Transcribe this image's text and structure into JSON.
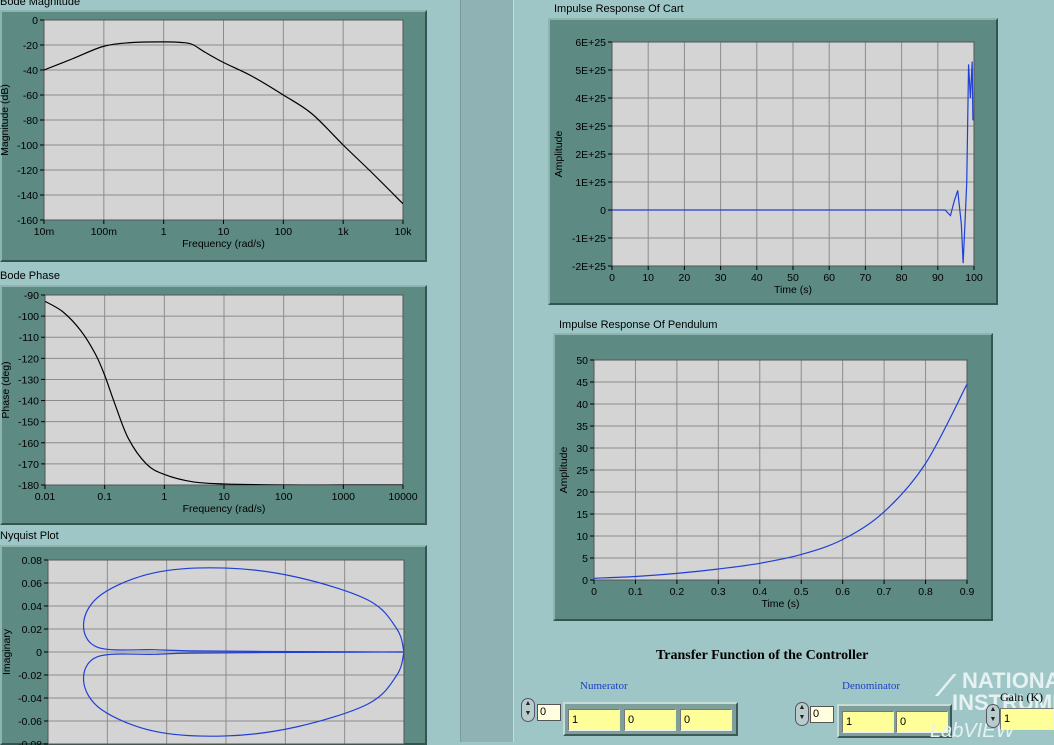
{
  "left_panel": {
    "bode_magnitude": {
      "title": "Bode Magnitude",
      "ylabel": "Magnitude (dB)",
      "xlabel": "Frequency (rad/s)",
      "yticks": [
        "0",
        "-20",
        "-40",
        "-60",
        "-80",
        "-100",
        "-120",
        "-140",
        "-160"
      ],
      "xticks": [
        "10m",
        "100m",
        "1",
        "10",
        "100",
        "1k",
        "10k"
      ]
    },
    "bode_phase": {
      "title": "Bode Phase",
      "ylabel": "Phase (deg)",
      "xlabel": "Frequency (rad/s)",
      "yticks": [
        "-90",
        "-100",
        "-110",
        "-120",
        "-130",
        "-140",
        "-150",
        "-160",
        "-170",
        "-180"
      ],
      "xticks": [
        "0.01",
        "0.1",
        "1",
        "10",
        "100",
        "1000",
        "10000"
      ]
    },
    "nyquist": {
      "title": "Nyquist Plot",
      "ylabel": "Imaginary",
      "yticks": [
        "0.08",
        "0.06",
        "0.04",
        "0.02",
        "0",
        "-0.02",
        "-0.04",
        "-0.06",
        "-0.08"
      ]
    }
  },
  "right_panel": {
    "cart": {
      "title": "Impulse Response  Of Cart",
      "ylabel": "Amplitude",
      "xlabel": "Time (s)",
      "yticks": [
        "6E+25",
        "5E+25",
        "4E+25",
        "3E+25",
        "2E+25",
        "1E+25",
        "0",
        "-1E+25",
        "-2E+25"
      ],
      "xticks": [
        "0",
        "10",
        "20",
        "30",
        "40",
        "50",
        "60",
        "70",
        "80",
        "90",
        "100"
      ]
    },
    "pendulum": {
      "title": "Impulse Response  Of Pendulum",
      "ylabel": "Amplitude",
      "xlabel": "Time (s)",
      "yticks": [
        "50",
        "45",
        "40",
        "35",
        "30",
        "25",
        "20",
        "15",
        "10",
        "5",
        "0"
      ],
      "xticks": [
        "0",
        "0.1",
        "0.2",
        "0.3",
        "0.4",
        "0.5",
        "0.6",
        "0.7",
        "0.8",
        "0.9"
      ]
    },
    "controller": {
      "title": "Transfer Function of the Controller",
      "numerator_label": "Numerator",
      "numerator_index": "0",
      "numerator_values": [
        "1",
        "0",
        "0"
      ],
      "denominator_label": "Denominator",
      "denominator_index": "0",
      "denominator_values": [
        "1",
        "0"
      ],
      "gain_label": "Gain (K)",
      "gain_value": "1"
    },
    "watermark": {
      "line1": "NATIONAL",
      "line2": "INSTRUMENTS",
      "line3": "LabVIEW  Evaluation"
    }
  },
  "colors": {
    "background": "#9fc6c6",
    "frame": "#5e8a84",
    "plot_bg": "#d4d4d4",
    "grid": "#8c8c8c",
    "trace_black": "#000000",
    "trace_blue": "#1f3fd6",
    "field_yellow": "#ffff99"
  },
  "chart_data": [
    {
      "type": "line",
      "title": "Bode Magnitude",
      "xlabel": "Frequency (rad/s)",
      "ylabel": "Magnitude (dB)",
      "xscale": "log",
      "xlim": [
        0.01,
        10000
      ],
      "ylim": [
        -160,
        0
      ],
      "grid": true,
      "series": [
        {
          "x": [
            0.01,
            0.03,
            0.1,
            0.3,
            1,
            2,
            3,
            5,
            10,
            30,
            100,
            300,
            1000,
            3000,
            10000
          ],
          "y": [
            -40,
            -31,
            -21,
            -18,
            -17.5,
            -18,
            -19.5,
            -26,
            -34,
            -45,
            -60,
            -75,
            -100,
            -122,
            -147
          ]
        }
      ]
    },
    {
      "type": "line",
      "title": "Bode Phase",
      "xlabel": "Frequency (rad/s)",
      "ylabel": "Phase (deg)",
      "xscale": "log",
      "xlim": [
        0.01,
        10000
      ],
      "ylim": [
        -180,
        -90
      ],
      "grid": true,
      "series": [
        {
          "x": [
            0.01,
            0.02,
            0.04,
            0.07,
            0.1,
            0.15,
            0.25,
            0.5,
            1,
            3,
            10,
            100,
            1000,
            10000
          ],
          "y": [
            -93,
            -98,
            -107,
            -118,
            -128,
            -142,
            -158,
            -170,
            -175,
            -178.5,
            -179.5,
            -180,
            -180,
            -180
          ]
        }
      ]
    },
    {
      "type": "line",
      "title": "Nyquist Plot",
      "ylabel": "Imaginary",
      "xlim": [
        -0.1,
        0.0
      ],
      "ylim": [
        -0.08,
        0.08
      ],
      "grid": true,
      "series": [
        {
          "x": [
            0,
            -0.002,
            -0.01,
            -0.03,
            -0.05,
            -0.07,
            -0.085,
            -0.09,
            -0.086,
            -0.07,
            -0.06,
            -0.04,
            -0.02,
            0
          ],
          "y": [
            0,
            0.02,
            0.045,
            0.065,
            0.073,
            0.069,
            0.05,
            0.025,
            0.004,
            0.002,
            0.001,
            0.0005,
            0.0002,
            0
          ]
        },
        {
          "x": [
            0,
            -0.002,
            -0.01,
            -0.03,
            -0.05,
            -0.07,
            -0.085,
            -0.09,
            -0.086,
            -0.07,
            -0.06,
            -0.04,
            -0.02,
            0
          ],
          "y": [
            0,
            -0.02,
            -0.045,
            -0.065,
            -0.073,
            -0.069,
            -0.05,
            -0.025,
            -0.004,
            -0.002,
            -0.001,
            -0.0005,
            -0.0002,
            0
          ]
        }
      ]
    },
    {
      "type": "line",
      "title": "Impulse Response  Of Cart",
      "xlabel": "Time (s)",
      "ylabel": "Amplitude",
      "xlim": [
        0,
        100
      ],
      "ylim": [
        -2e+25,
        6e+25
      ],
      "grid": true,
      "series": [
        {
          "x": [
            0,
            36,
            60,
            85,
            92,
            93.5,
            94.5,
            95.5,
            96.5,
            97,
            97.5,
            98,
            98.5,
            99,
            99.5,
            99.7
          ],
          "y": [
            0,
            0,
            0,
            0,
            0,
            -2e+24,
            3e+24,
            7e+24,
            -5e+24,
            -1.9e+25,
            -5e+24,
            1e+25,
            5.2e+25,
            4e+25,
            5.3e+25,
            3.2e+25
          ]
        }
      ]
    },
    {
      "type": "line",
      "title": "Impulse Response  Of Pendulum",
      "xlabel": "Time (s)",
      "ylabel": "Amplitude",
      "xlim": [
        0,
        0.9
      ],
      "ylim": [
        0,
        50
      ],
      "grid": true,
      "series": [
        {
          "x": [
            0,
            0.1,
            0.2,
            0.3,
            0.4,
            0.5,
            0.6,
            0.7,
            0.8,
            0.9
          ],
          "y": [
            0.4,
            0.8,
            1.5,
            2.5,
            3.8,
            5.8,
            9.2,
            15.5,
            26.5,
            44.5
          ]
        }
      ]
    }
  ]
}
